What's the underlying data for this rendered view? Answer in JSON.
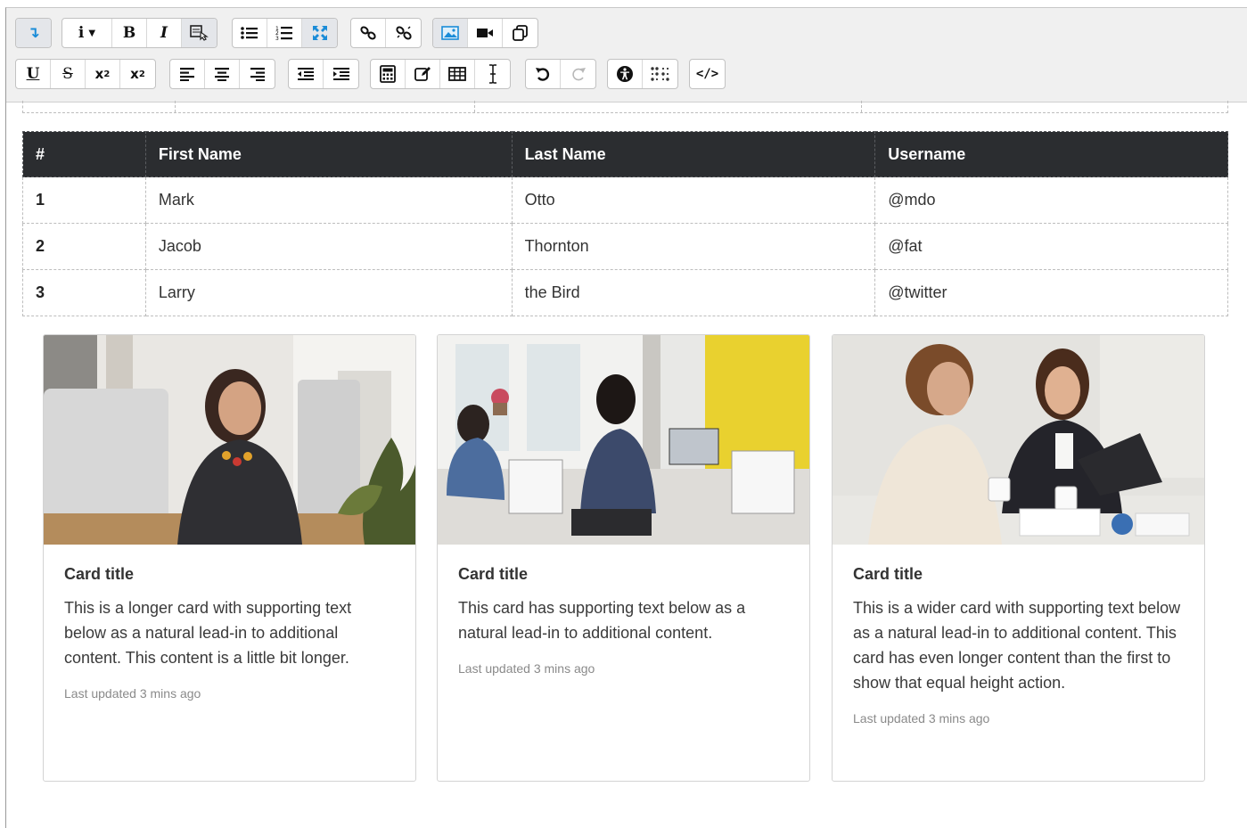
{
  "toolbar": {
    "row1": [
      {
        "name": "collapse-toolbar-icon",
        "glyph": "↴"
      },
      {
        "name": "info-dropdown-icon",
        "glyph": "i ▾"
      },
      {
        "name": "bold-icon",
        "glyph": "B"
      },
      {
        "name": "italic-icon",
        "glyph": "I"
      },
      {
        "name": "style-click-icon",
        "glyph": "🖱"
      },
      {
        "name": "unordered-list-icon",
        "glyph": "☰"
      },
      {
        "name": "ordered-list-icon",
        "glyph": "☷"
      },
      {
        "name": "fullscreen-icon",
        "glyph": "✥"
      },
      {
        "name": "link-icon",
        "glyph": "🔗"
      },
      {
        "name": "unlink-icon",
        "glyph": "⛓"
      },
      {
        "name": "image-icon",
        "glyph": "🖼"
      },
      {
        "name": "video-icon",
        "glyph": "■"
      },
      {
        "name": "manage-files-icon",
        "glyph": "⧉"
      }
    ],
    "row2": [
      {
        "name": "underline-icon",
        "glyph": "U"
      },
      {
        "name": "strikethrough-icon",
        "glyph": "S"
      },
      {
        "name": "subscript-icon",
        "glyph": "x₂"
      },
      {
        "name": "superscript-icon",
        "glyph": "x²"
      },
      {
        "name": "align-left-icon",
        "glyph": "≡"
      },
      {
        "name": "align-center-icon",
        "glyph": "≡"
      },
      {
        "name": "align-right-icon",
        "glyph": "≡"
      },
      {
        "name": "outdent-icon",
        "glyph": "⇤"
      },
      {
        "name": "indent-icon",
        "glyph": "⇥"
      },
      {
        "name": "equation-icon",
        "glyph": "▦"
      },
      {
        "name": "edit-icon",
        "glyph": "✎"
      },
      {
        "name": "table-icon",
        "glyph": "▦"
      },
      {
        "name": "text-cursor-icon",
        "glyph": "I"
      },
      {
        "name": "undo-icon",
        "glyph": "↶"
      },
      {
        "name": "redo-icon",
        "glyph": "↷"
      },
      {
        "name": "accessibility-icon",
        "glyph": "♿"
      },
      {
        "name": "screenreader-icon",
        "glyph": "⠿"
      },
      {
        "name": "html-source-icon",
        "glyph": "</>"
      }
    ]
  },
  "table": {
    "headers": [
      "#",
      "First Name",
      "Last Name",
      "Username"
    ],
    "rows": [
      [
        "1",
        "Mark",
        "Otto",
        "@mdo"
      ],
      [
        "2",
        "Jacob",
        "Thornton",
        "@fat"
      ],
      [
        "3",
        "Larry",
        "the Bird",
        "@twitter"
      ]
    ]
  },
  "cards": [
    {
      "title": "Card title",
      "text": "This is a longer card with supporting text below as a natural lead-in to additional content. This content is a little bit longer.",
      "meta": "Last updated 3 mins ago"
    },
    {
      "title": "Card title",
      "text": "This card has supporting text below as a natural lead-in to additional content.",
      "meta": "Last updated 3 mins ago"
    },
    {
      "title": "Card title",
      "text": "This is a wider card with supporting text below as a natural lead-in to additional content. This card has even longer content than the first to show that equal height action.",
      "meta": "Last updated 3 mins ago"
    }
  ]
}
